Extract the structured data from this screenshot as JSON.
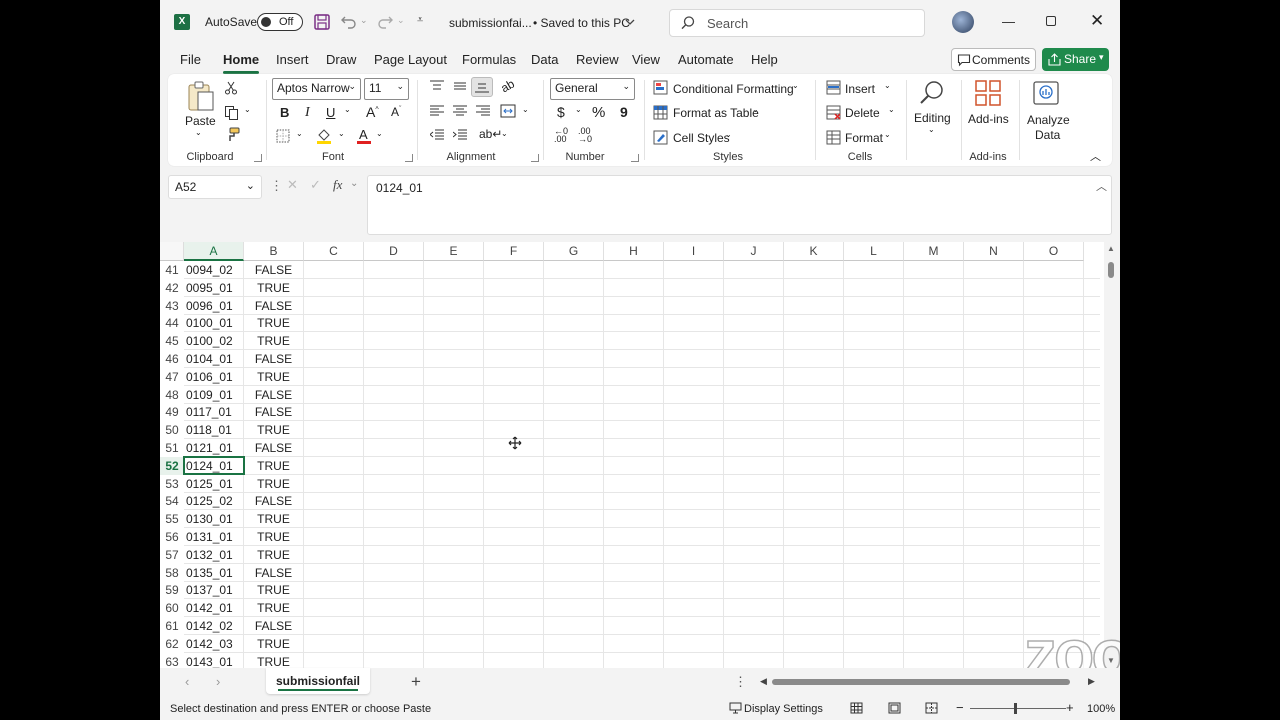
{
  "titlebar": {
    "autosave_label": "AutoSave",
    "autosave_state": "Off",
    "filename": "submissionfai...",
    "save_status": "• Saved to this PC",
    "search_placeholder": "Search"
  },
  "menu": {
    "tabs": [
      "File",
      "Home",
      "Insert",
      "Draw",
      "Page Layout",
      "Formulas",
      "Data",
      "Review",
      "View",
      "Automate",
      "Help"
    ],
    "active": "Home",
    "comments_label": "Comments",
    "share_label": "Share"
  },
  "ribbon": {
    "clipboard": {
      "paste": "Paste",
      "label": "Clipboard"
    },
    "font": {
      "name": "Aptos Narrow",
      "size": "11",
      "label": "Font"
    },
    "alignment": {
      "label": "Alignment"
    },
    "number": {
      "format": "General",
      "label": "Number",
      "currency": "$",
      "percent": "%",
      "comma": "9"
    },
    "styles": {
      "conditional": "Conditional Formatting",
      "format_table": "Format as Table",
      "cell_styles": "Cell Styles",
      "label": "Styles"
    },
    "cells": {
      "insert": "Insert",
      "delete": "Delete",
      "format": "Format",
      "label": "Cells"
    },
    "editing": {
      "label": "Editing"
    },
    "addins": {
      "button": "Add-ins",
      "label": "Add-ins"
    },
    "analyze": {
      "line1": "Analyze",
      "line2": "Data"
    }
  },
  "formula_bar": {
    "name_box": "A52",
    "content": "0124_01"
  },
  "grid": {
    "columns": [
      "A",
      "B",
      "C",
      "D",
      "E",
      "F",
      "G",
      "H",
      "I",
      "J",
      "K",
      "L",
      "M",
      "N",
      "O"
    ],
    "selected_column": "A",
    "selected_row": 52,
    "rows": [
      {
        "n": "41",
        "a": "0094_02",
        "b": "FALSE"
      },
      {
        "n": "42",
        "a": "0095_01",
        "b": "TRUE"
      },
      {
        "n": "43",
        "a": "0096_01",
        "b": "FALSE"
      },
      {
        "n": "44",
        "a": "0100_01",
        "b": "TRUE"
      },
      {
        "n": "45",
        "a": "0100_02",
        "b": "TRUE"
      },
      {
        "n": "46",
        "a": "0104_01",
        "b": "FALSE"
      },
      {
        "n": "47",
        "a": "0106_01",
        "b": "TRUE"
      },
      {
        "n": "48",
        "a": "0109_01",
        "b": "FALSE"
      },
      {
        "n": "49",
        "a": "0117_01",
        "b": "FALSE"
      },
      {
        "n": "50",
        "a": "0118_01",
        "b": "TRUE"
      },
      {
        "n": "51",
        "a": "0121_01",
        "b": "FALSE"
      },
      {
        "n": "52",
        "a": "0124_01",
        "b": "TRUE"
      },
      {
        "n": "53",
        "a": "0125_01",
        "b": "TRUE"
      },
      {
        "n": "54",
        "a": "0125_02",
        "b": "FALSE"
      },
      {
        "n": "55",
        "a": "0130_01",
        "b": "TRUE"
      },
      {
        "n": "56",
        "a": "0131_01",
        "b": "TRUE"
      },
      {
        "n": "57",
        "a": "0132_01",
        "b": "TRUE"
      },
      {
        "n": "58",
        "a": "0135_01",
        "b": "FALSE"
      },
      {
        "n": "59",
        "a": "0137_01",
        "b": "TRUE"
      },
      {
        "n": "60",
        "a": "0142_01",
        "b": "TRUE"
      },
      {
        "n": "61",
        "a": "0142_02",
        "b": "FALSE"
      },
      {
        "n": "62",
        "a": "0142_03",
        "b": "TRUE"
      },
      {
        "n": "63",
        "a": "0143_01",
        "b": "TRUE"
      }
    ]
  },
  "sheets": {
    "active": "submissionfail",
    "add": "+"
  },
  "statusbar": {
    "message": "Select destination and press ENTER or choose Paste",
    "display_settings": "Display Settings",
    "zoom": "100%",
    "zoom_level_percent": 100
  },
  "overlay": {
    "watermark": "zoom"
  },
  "colors": {
    "accent": "#1a7343",
    "share_bg": "#1f8a4c"
  }
}
